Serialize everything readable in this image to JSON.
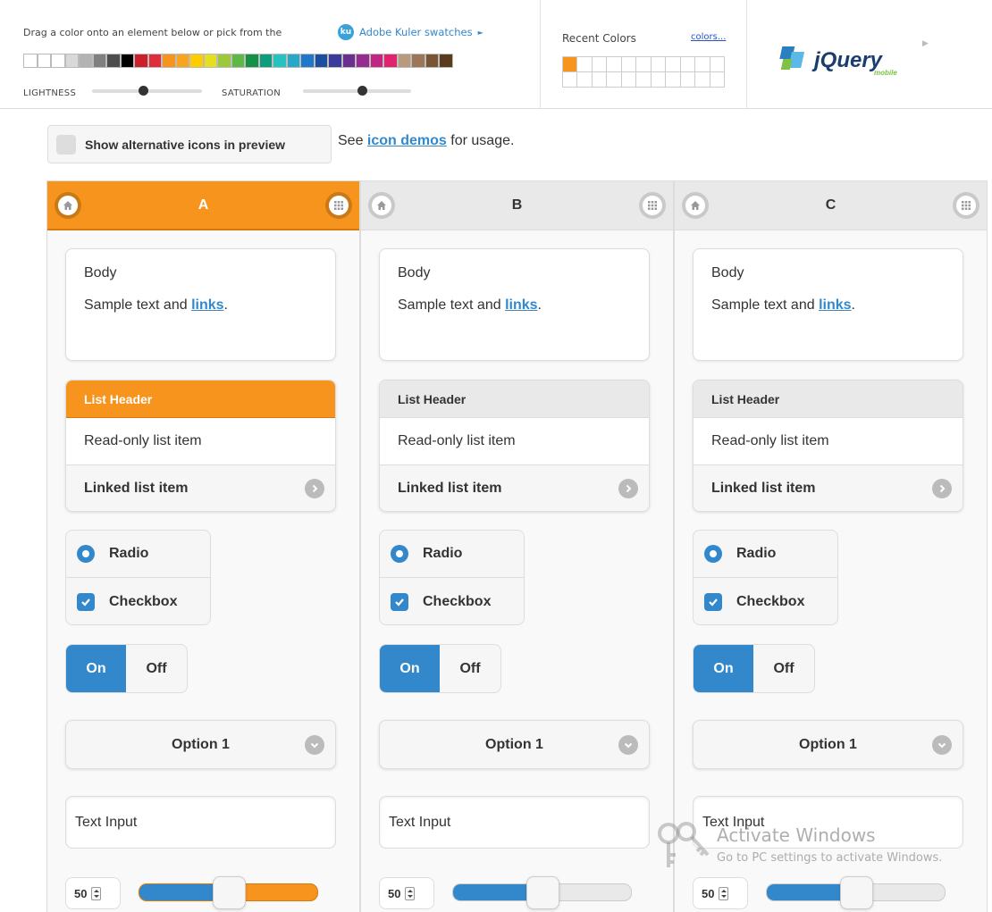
{
  "toolbar": {
    "drag_text": "Drag a color onto an element below or pick from the",
    "kuler_link": "Adobe Kuler swatches",
    "kuler_badge": "ku",
    "lightness_label": "LIGHTNESS",
    "saturation_label": "SATURATION",
    "lightness_value": 0.42,
    "saturation_value": 0.5,
    "swatches": [
      "#ffffff",
      "#ffffff",
      "#ffffff",
      "#d9d9d9",
      "#b3b3b3",
      "#808080",
      "#4d4d4d",
      "#000000",
      "#cc1f2c",
      "#e02d3c",
      "#f7941d",
      "#f9a51c",
      "#ffcc00",
      "#e5e01f",
      "#9cc83c",
      "#5fb845",
      "#149145",
      "#0d9d7d",
      "#26c2c0",
      "#28a7c9",
      "#1f78c9",
      "#1c4ea0",
      "#3b3b9e",
      "#6a2f8f",
      "#962c8f",
      "#c12782",
      "#e0226f",
      "#b79b7c",
      "#9b7757",
      "#7a5533",
      "#5a3b1e"
    ],
    "recent_label": "Recent Colors",
    "colors_link": "colors...",
    "recent_colors": [
      "#f7941d"
    ],
    "logo_text": "jQuery",
    "logo_sub": "mobile"
  },
  "alt_icons": {
    "label": "Show alternative icons in preview",
    "checked": false
  },
  "icon_demos": {
    "prefix": "See ",
    "link": "icon demos",
    "suffix": " for usage."
  },
  "columns": [
    {
      "letter": "A",
      "body_title": "Body",
      "sample_prefix": "Sample text and ",
      "sample_link": "links",
      "sample_suffix": ".",
      "list_header": "List Header",
      "readonly_item": "Read-only list item",
      "linked_item": "Linked list item",
      "radio_label": "Radio",
      "checkbox_label": "Checkbox",
      "flip_on": "On",
      "flip_off": "Off",
      "select_value": "Option 1",
      "text_input": "Text Input",
      "number_value": "50",
      "slider_value": 0.5,
      "accent": "#f7941d"
    },
    {
      "letter": "B",
      "body_title": "Body",
      "sample_prefix": "Sample text and ",
      "sample_link": "links",
      "sample_suffix": ".",
      "list_header": "List Header",
      "readonly_item": "Read-only list item",
      "linked_item": "Linked list item",
      "radio_label": "Radio",
      "checkbox_label": "Checkbox",
      "flip_on": "On",
      "flip_off": "Off",
      "select_value": "Option 1",
      "text_input": "Text Input",
      "number_value": "50",
      "slider_value": 0.5,
      "accent": "#e9e9e9"
    },
    {
      "letter": "C",
      "body_title": "Body",
      "sample_prefix": "Sample text and ",
      "sample_link": "links",
      "sample_suffix": ".",
      "list_header": "List Header",
      "readonly_item": "Read-only list item",
      "linked_item": "Linked list item",
      "radio_label": "Radio",
      "checkbox_label": "Checkbox",
      "flip_on": "On",
      "flip_off": "Off",
      "select_value": "Option 1",
      "text_input": "Text Input",
      "number_value": "50",
      "slider_value": 0.5,
      "accent": "#e9e9e9"
    }
  ],
  "colors": {
    "accent_orange": "#f7941d",
    "link_blue": "#3388cc"
  },
  "watermark": {
    "title": "Activate Windows",
    "subtitle": "Go to PC settings to activate Windows."
  }
}
